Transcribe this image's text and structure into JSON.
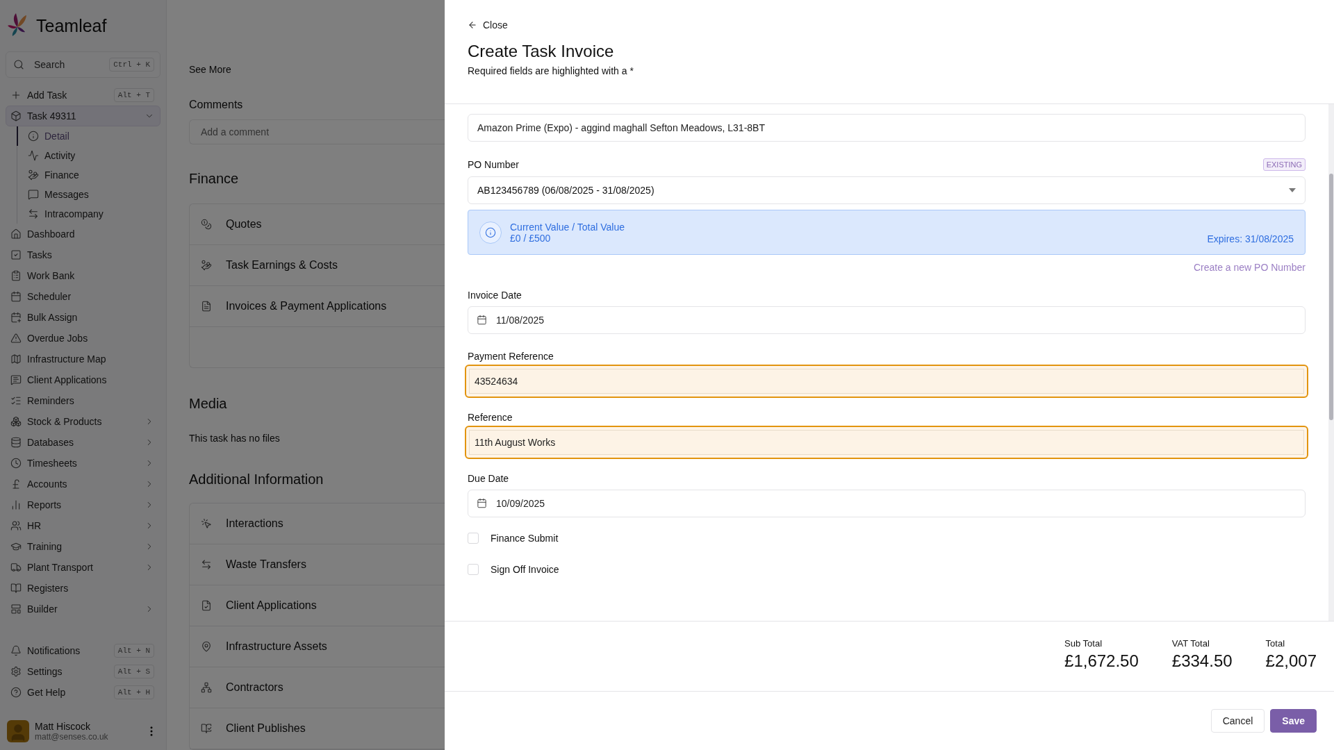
{
  "sidebar": {
    "brand": "Teamleaf",
    "search": {
      "placeholder": "Search",
      "shortcut": "Ctrl + K"
    },
    "add_task": {
      "label": "Add Task",
      "shortcut": "Alt + T"
    },
    "task": {
      "label": "Task 49311",
      "expanded": true,
      "children": [
        {
          "label": "Detail",
          "selected": true
        },
        {
          "label": "Activity",
          "selected": false
        },
        {
          "label": "Finance",
          "selected": false
        },
        {
          "label": "Messages",
          "selected": false
        },
        {
          "label": "Intracompany",
          "selected": false
        }
      ]
    },
    "items": [
      {
        "label": "Dashboard",
        "has_submenu": false
      },
      {
        "label": "Tasks",
        "has_submenu": false
      },
      {
        "label": "Work Bank",
        "has_submenu": false
      },
      {
        "label": "Scheduler",
        "has_submenu": false
      },
      {
        "label": "Bulk Assign",
        "has_submenu": false
      },
      {
        "label": "Overdue Jobs",
        "has_submenu": false
      },
      {
        "label": "Infrastructure Map",
        "has_submenu": false
      },
      {
        "label": "Client Applications",
        "has_submenu": false
      },
      {
        "label": "Reminders",
        "has_submenu": false
      },
      {
        "label": "Stock & Products",
        "has_submenu": true
      },
      {
        "label": "Databases",
        "has_submenu": true
      },
      {
        "label": "Timesheets",
        "has_submenu": true
      },
      {
        "label": "Accounts",
        "has_submenu": true
      },
      {
        "label": "Reports",
        "has_submenu": true
      },
      {
        "label": "HR",
        "has_submenu": true
      },
      {
        "label": "Training",
        "has_submenu": true
      },
      {
        "label": "Plant Transport",
        "has_submenu": true
      },
      {
        "label": "Registers",
        "has_submenu": false
      },
      {
        "label": "Builder",
        "has_submenu": true
      }
    ],
    "footer_items": [
      {
        "label": "Notifications",
        "shortcut": "Alt + N"
      },
      {
        "label": "Settings",
        "shortcut": "Alt + S"
      },
      {
        "label": "Get Help",
        "shortcut": "Alt + H"
      }
    ],
    "user": {
      "name": "Matt Hiscock",
      "email": "matt@senses.co.uk"
    }
  },
  "main": {
    "see_more": "See More",
    "comments": {
      "heading": "Comments",
      "placeholder": "Add a comment"
    },
    "finance": {
      "heading": "Finance",
      "rows": [
        "Quotes",
        "Task Earnings & Costs",
        "Invoices & Payment Applications"
      ]
    },
    "media": {
      "heading": "Media",
      "empty": "This task has no files"
    },
    "additional": {
      "heading": "Additional Information",
      "rows": [
        "Interactions",
        "Waste Transfers",
        "Client Applications",
        "Infrastructure Assets",
        "Contractors",
        "Client Publishes"
      ]
    }
  },
  "panel": {
    "close": "Close",
    "title": "Create Task Invoice",
    "subtitle": "Required fields are highlighted with a *",
    "fields": [
      {
        "kind": "text",
        "value": "Amazon Prime (Expo) - aggind maghall Sefton Meadows, L31-8BT",
        "highlighted": false
      },
      {
        "kind": "select",
        "label": "PO Number",
        "badge": "EXISTING",
        "value": "AB123456789 (06/08/2025 - 31/08/2025)",
        "info": {
          "title": "Current Value / Total Value",
          "amount": "£0 / £500",
          "expires": "Expires: 31/08/2025"
        },
        "link": "Create a new PO Number"
      },
      {
        "kind": "date",
        "label": "Invoice Date",
        "value": "11/08/2025"
      },
      {
        "kind": "text",
        "label": "Payment Reference",
        "value": "43524634",
        "highlighted": true
      },
      {
        "kind": "text",
        "label": "Reference",
        "value": "11th August Works",
        "highlighted": true
      },
      {
        "kind": "date",
        "label": "Due Date",
        "value": "10/09/2025"
      }
    ],
    "checkboxes": [
      {
        "label": "Finance Submit",
        "checked": false
      },
      {
        "label": "Sign Off Invoice",
        "checked": false
      }
    ],
    "totals": [
      {
        "label": "Sub Total",
        "value": "£1,672.50"
      },
      {
        "label": "VAT Total",
        "value": "£334.50"
      },
      {
        "label": "Total",
        "value": "£2,007"
      }
    ],
    "buttons": [
      {
        "label": "Cancel",
        "kind": "secondary"
      },
      {
        "label": "Save",
        "kind": "primary"
      }
    ]
  }
}
